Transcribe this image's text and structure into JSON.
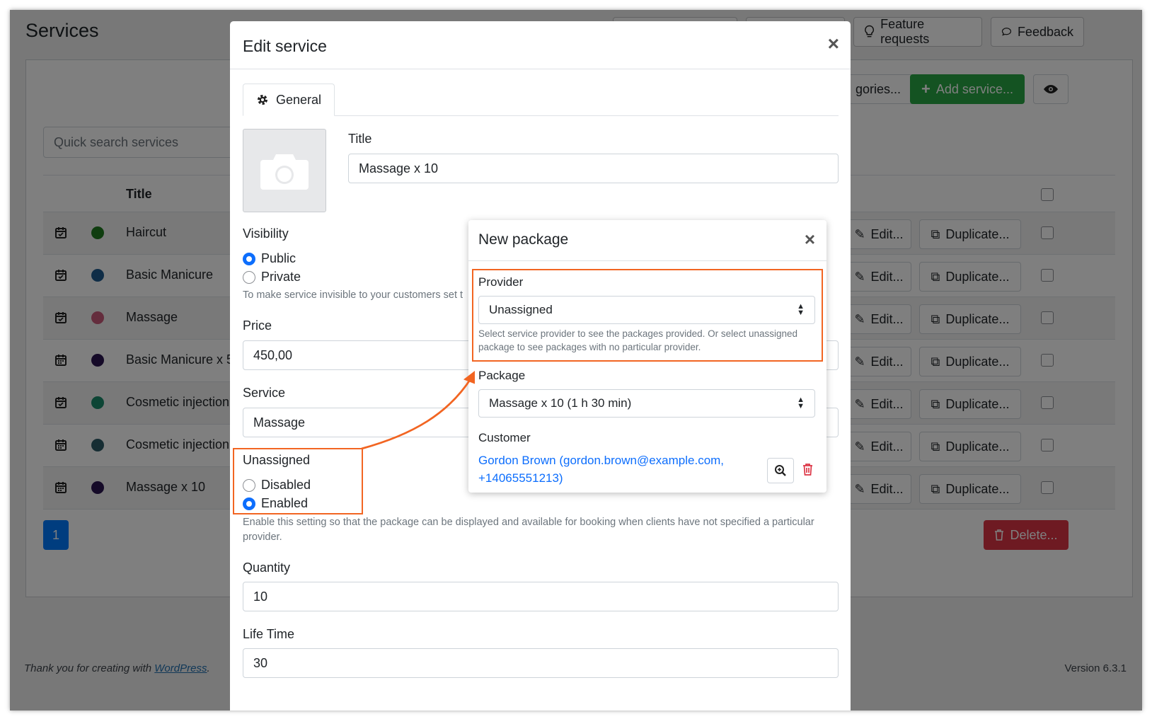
{
  "background": {
    "page_title": "Services",
    "top_buttons": {
      "feature_requests": "Feature requests",
      "feedback": "Feedback"
    },
    "search_placeholder": "Quick search services",
    "categories_button": "gories...",
    "add_service_button": "Add service...",
    "table_header_title": "Title",
    "rows": [
      {
        "title": "Haircut",
        "color": "#1e7a1e",
        "icon": "calendar-check-icon"
      },
      {
        "title": "Basic Manicure",
        "color": "#1f5a8f",
        "icon": "calendar-check-icon"
      },
      {
        "title": "Massage",
        "color": "#c85a7a",
        "icon": "calendar-check-icon"
      },
      {
        "title": "Basic Manicure x 5",
        "color": "#2b1450",
        "icon": "calendar-icon"
      },
      {
        "title": "Cosmetic injection",
        "color": "#1a8a6a",
        "icon": "calendar-check-icon"
      },
      {
        "title": "Cosmetic injection",
        "color": "#2c5a66",
        "icon": "calendar-icon"
      },
      {
        "title": "Massage x 10",
        "color": "#2b1450",
        "icon": "calendar-icon"
      }
    ],
    "edit_label": "Edit...",
    "duplicate_label": "Duplicate...",
    "page_number": "1",
    "delete_button": "Delete...",
    "footer_text": "Thank you for creating with ",
    "footer_link": "WordPress",
    "footer_suffix": ".",
    "version": "Version 6.3.1"
  },
  "edit_modal": {
    "title": "Edit service",
    "tab_general": "General",
    "title_label": "Title",
    "title_value": "Massage x 10",
    "visibility_label": "Visibility",
    "visibility_public": "Public",
    "visibility_private": "Private",
    "visibility_help": "To make service invisible to your customers set t",
    "price_label": "Price",
    "price_value": "450,00",
    "service_label": "Service",
    "service_value": "Massage",
    "unassigned_label": "Unassigned",
    "unassigned_disabled": "Disabled",
    "unassigned_enabled": "Enabled",
    "unassigned_help": "Enable this setting so that the package can be displayed and available for booking when clients have not specified a particular provider.",
    "quantity_label": "Quantity",
    "quantity_value": "10",
    "lifetime_label": "Life Time",
    "lifetime_value": "30"
  },
  "package_popup": {
    "title": "New package",
    "provider_label": "Provider",
    "provider_value": "Unassigned",
    "provider_help": "Select service provider to see the packages provided. Or select unassigned package to see packages with no particular provider.",
    "package_label": "Package",
    "package_value": "Massage x 10 (1 h 30 min)",
    "customer_label": "Customer",
    "customer_line1": "Gordon Brown (gordon.brown@example.com,",
    "customer_line2": "+14065551213)"
  },
  "colors": {
    "accent": "#0d6efd",
    "highlight": "#f26522",
    "success": "#28a745",
    "danger": "#dc3545"
  }
}
